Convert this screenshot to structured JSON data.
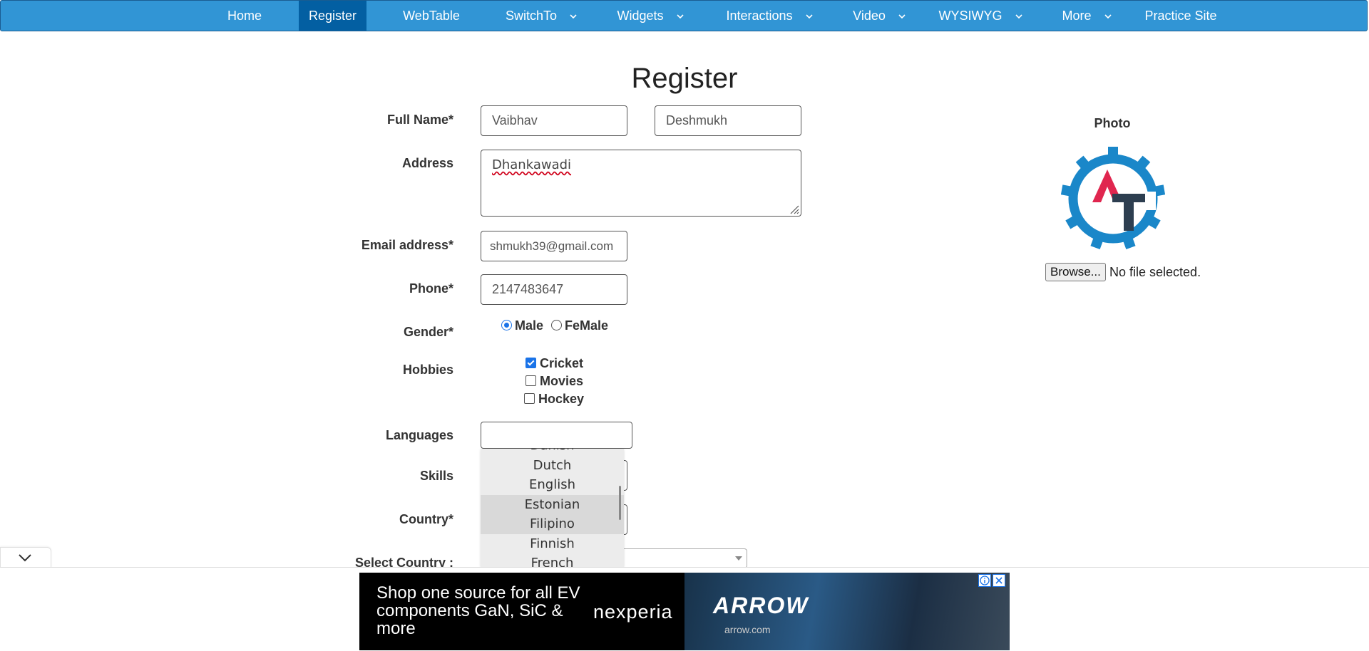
{
  "nav": {
    "items": [
      {
        "label": "Home",
        "has_dropdown": false
      },
      {
        "label": "Register",
        "has_dropdown": false,
        "active": true
      },
      {
        "label": "WebTable",
        "has_dropdown": false
      },
      {
        "label": "SwitchTo",
        "has_dropdown": true
      },
      {
        "label": "Widgets",
        "has_dropdown": true
      },
      {
        "label": "Interactions",
        "has_dropdown": true
      },
      {
        "label": "Video",
        "has_dropdown": true
      },
      {
        "label": "WYSIWYG",
        "has_dropdown": true
      },
      {
        "label": "More",
        "has_dropdown": true
      },
      {
        "label": "Practice Site",
        "has_dropdown": false
      }
    ],
    "background_color": "#3195d5",
    "active_color": "#035fa2"
  },
  "form": {
    "title": "Register",
    "full_name_label": "Full Name*",
    "first_name_value": "Vaibhav",
    "last_name_value": "Deshmukh",
    "address_label": "Address",
    "address_value": "Dhankawadi",
    "email_label": "Email address*",
    "email_value": "shmukh39@gmail.com",
    "phone_label": "Phone*",
    "phone_value": "2147483647",
    "gender_label": "Gender*",
    "gender_options": [
      "Male",
      "FeMale"
    ],
    "gender_selected": "Male",
    "hobbies_label": "Hobbies",
    "hobbies": [
      {
        "label": "Cricket",
        "checked": true
      },
      {
        "label": "Movies",
        "checked": false
      },
      {
        "label": "Hockey",
        "checked": false
      }
    ],
    "languages_label": "Languages",
    "skills_label": "Skills",
    "country_label": "Country*",
    "select_country_label": "Select Country :",
    "languages_dropdown": [
      "Danish",
      "Dutch",
      "English",
      "Estonian",
      "Filipino",
      "Finnish",
      "French"
    ],
    "languages_hovered": [
      "Estonian",
      "Filipino"
    ]
  },
  "photo": {
    "label": "Photo",
    "browse_label": "Browse...",
    "file_status": "No file selected.",
    "logo_colors": {
      "gear": "#1a87c9",
      "a": "#e0264f",
      "t": "#2d3e50"
    }
  },
  "ad": {
    "headline": "Shop one source for all EV components GaN, SiC & more",
    "brand": "nexperia",
    "partner": "ARROW",
    "partner_url": "arrow.com"
  }
}
